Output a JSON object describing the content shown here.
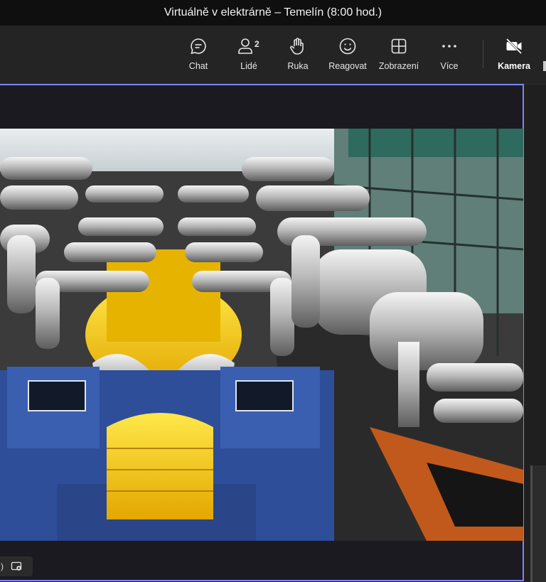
{
  "window": {
    "title": "Virtuálně v elektrárně – Temelín (8:00 hod.)"
  },
  "toolbar": {
    "chat_label": "Chat",
    "people_label": "Lidé",
    "people_count": "2",
    "raise_hand_label": "Ruka",
    "react_label": "Reagovat",
    "view_label": "Zobrazení",
    "more_label": "Více",
    "camera_label": "Kamera"
  },
  "video": {
    "participant_suffix": ")",
    "content": "turbine hall video feed"
  },
  "colors": {
    "active_border": "#7f85f5",
    "toolbar_bg": "#242424",
    "titlebar_bg": "#0f0f10"
  }
}
